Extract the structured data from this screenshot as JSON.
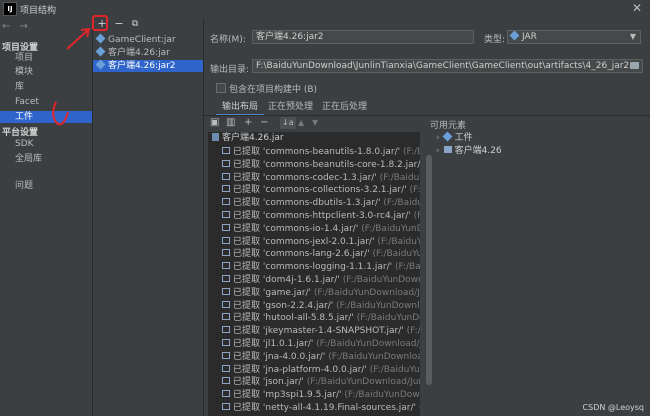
{
  "window": {
    "title": "项目结构",
    "logo": "IJ"
  },
  "nav": {
    "arrows": "← →",
    "sections": [
      {
        "heading": "项目设置",
        "items": [
          "项目",
          "模块",
          "库",
          "Facet",
          "工件"
        ]
      },
      {
        "heading": "平台设置",
        "items": [
          "SDK",
          "全局库"
        ]
      }
    ],
    "extra": "问题",
    "selected": "工件"
  },
  "artifacts": {
    "toolbar": {
      "add": "+",
      "remove": "−",
      "copy": "⧉"
    },
    "items": [
      "GameClient:jar",
      "客户端4.26:jar",
      "客户端4.26:jar2"
    ],
    "selected_index": 2
  },
  "form": {
    "name_label": "名称(M):",
    "name_value": "客户端4.26:jar2",
    "type_label": "类型:",
    "type_value": "JAR",
    "output_label": "输出目录:",
    "output_value": "F:\\BaiduYunDownload\\JunlinTianxia\\GameClient\\GameClient\\out\\artifacts\\4_26_jar2",
    "include_label": "包含在项目构建中 (B)"
  },
  "tabs": [
    "输出布局",
    "正在预处理",
    "正在后处理"
  ],
  "layout_toolbar": [
    "▣",
    "▥",
    "+",
    "−",
    "↓a",
    "▲",
    "▼"
  ],
  "layout": {
    "root": "客户端4.26.jar",
    "prefix": "已提取",
    "libraries": [
      {
        "name": "'commons-beanutils-1.8.0.jar/'",
        "path": "(F:/BaiduYunDownload"
      },
      {
        "name": "'commons-beanutils-core-1.8.2.jar/'",
        "path": "(F:/BaiduYunD"
      },
      {
        "name": "'commons-codec-1.3.jar/'",
        "path": "(F:/BaiduYunDownload/Ju"
      },
      {
        "name": "'commons-collections-3.2.1.jar/'",
        "path": "(F:/BaiduYunDownl"
      },
      {
        "name": "'commons-dbutils-1.3.jar/'",
        "path": "(F:/BaiduYunDownload/J"
      },
      {
        "name": "'commons-httpclient-3.0-rc4.jar/'",
        "path": "(F:/BaiduYunDown"
      },
      {
        "name": "'commons-io-1.4.jar/'",
        "path": "(F:/BaiduYunDownload/Junlin"
      },
      {
        "name": "'commons-jexl-2.0.1.jar/'",
        "path": "(F:/BaiduYunDownload/Ju"
      },
      {
        "name": "'commons-lang-2.6.jar/'",
        "path": "(F:/BaiduYunDownload/Junli"
      },
      {
        "name": "'commons-logging-1.1.1.jar/'",
        "path": "(F:/BaiduYunDownload/"
      },
      {
        "name": "'dom4j-1.6.1.jar/'",
        "path": "(F:/BaiduYunDownload/JunlinTianx"
      },
      {
        "name": "'game.jar/'",
        "path": "(F:/BaiduYunDownload/JunlinTianxia/Gam"
      },
      {
        "name": "'gson-2.2.4.jar/'",
        "path": "(F:/BaiduYunDownload/JunlinTianxia"
      },
      {
        "name": "'hutool-all-5.8.5.jar/'",
        "path": "(F:/BaiduYunDownload/Junlin"
      },
      {
        "name": "'jkeymaster-1.4-SNAPSHOT.jar/'",
        "path": "(F:/BaiduYunDownl"
      },
      {
        "name": "'jl1.0.1.jar/'",
        "path": "(F:/BaiduYunDownload/JunlinTianxia/"
      },
      {
        "name": "'jna-4.0.0.jar/'",
        "path": "(F:/BaiduYunDownload/JunlinTianxia"
      },
      {
        "name": "'jna-platform-4.0.0.jar/'",
        "path": "(F:/BaiduYunDownload/Ju"
      },
      {
        "name": "'json.jar/'",
        "path": "(F:/BaiduYunDownload/JunlinTianxia/Gam"
      },
      {
        "name": "'mp3spi1.9.5.jar/'",
        "path": "(F:/BaiduYunDownload/JunlinTia"
      },
      {
        "name": "'netty-all-4.1.19.Final-sources.jar/'",
        "path": "(F:/BaiduYunD"
      }
    ]
  },
  "available": {
    "label": "可用元素",
    "items": [
      "工件",
      "客户端4.26"
    ]
  },
  "watermark": "CSDN @Leoysq",
  "colors": {
    "selection": "#2f65ca",
    "annotation": "#e0262a",
    "background": "#3c3f41",
    "panel": "#2b2b2b"
  }
}
